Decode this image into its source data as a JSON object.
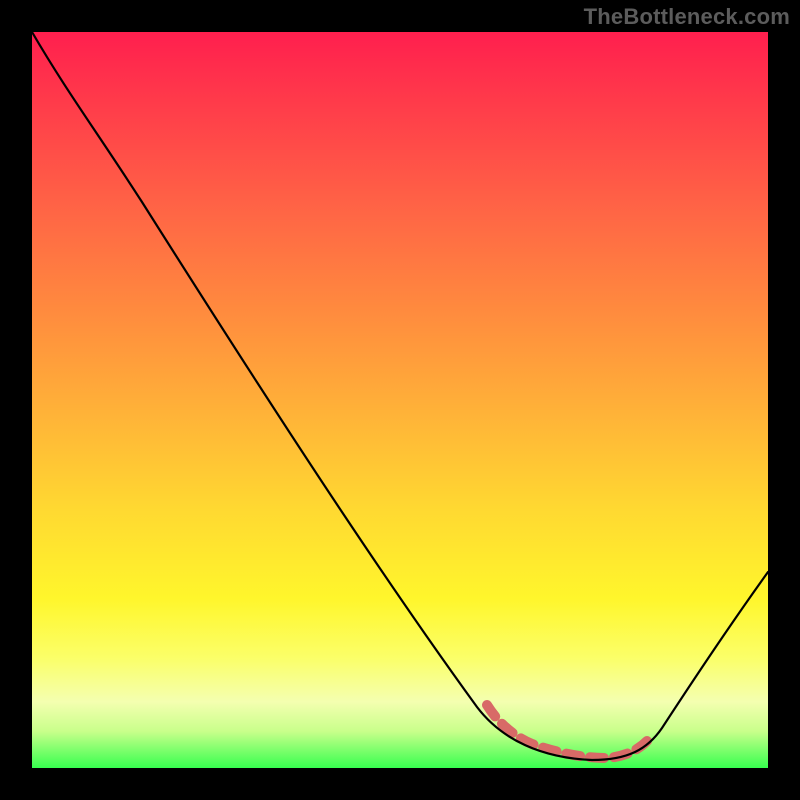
{
  "watermark": "TheBottleneck.com",
  "colors": {
    "background": "#000000",
    "gradient_top": "#ff1f4e",
    "gradient_mid": "#ffd931",
    "gradient_bottom": "#37ff4f",
    "curve": "#000000",
    "floor_marker": "#d86a67"
  },
  "chart_data": {
    "type": "line",
    "title": "",
    "xlabel": "",
    "ylabel": "",
    "xlim": [
      0,
      100
    ],
    "ylim": [
      0,
      100
    ],
    "x": [
      0,
      5,
      10,
      15,
      20,
      25,
      30,
      35,
      40,
      45,
      50,
      55,
      60,
      62,
      65,
      70,
      75,
      80,
      83,
      86,
      90,
      95,
      100
    ],
    "values": [
      100,
      96,
      91,
      84,
      76,
      68,
      60,
      52,
      44,
      36,
      28,
      20,
      12,
      9,
      6,
      3,
      1.5,
      1,
      2,
      4,
      9,
      17,
      27
    ],
    "floor_region_x": [
      62,
      83
    ],
    "note": "V-shaped bottleneck curve with flattened minimum around x≈70–80; values are percentage of height from top (0) to bottom (100) estimated from pixels."
  }
}
